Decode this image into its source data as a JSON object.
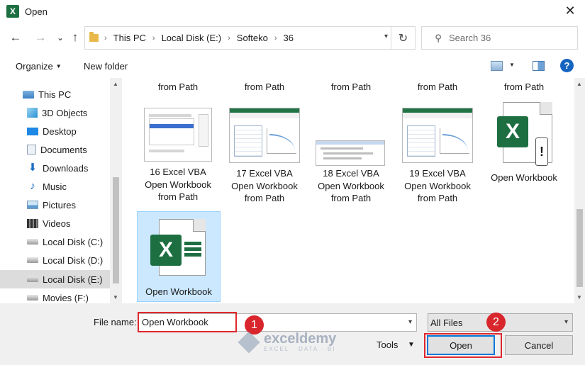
{
  "window": {
    "title": "Open",
    "close_glyph": "✕",
    "app_icon_letter": "X"
  },
  "nav": {
    "back_glyph": "←",
    "forward_glyph": "→",
    "recent_glyph": "⌄",
    "up_glyph": "↑",
    "breadcrumbs": [
      "This PC",
      "Local Disk (E:)",
      "Softeko",
      "36"
    ],
    "sep_glyph": "›",
    "refresh_glyph": "↻",
    "search_placeholder": "Search 36",
    "search_glyph": "⚲"
  },
  "toolbar": {
    "organize": "Organize",
    "new_folder": "New folder",
    "help": "?"
  },
  "sidebar": {
    "items": [
      {
        "label": "This PC",
        "icon": "computer-icon"
      },
      {
        "label": "3D Objects",
        "icon": "cube-icon"
      },
      {
        "label": "Desktop",
        "icon": "desktop-icon"
      },
      {
        "label": "Documents",
        "icon": "documents-icon"
      },
      {
        "label": "Downloads",
        "icon": "download-icon"
      },
      {
        "label": "Music",
        "icon": "music-icon"
      },
      {
        "label": "Pictures",
        "icon": "pictures-icon"
      },
      {
        "label": "Videos",
        "icon": "videos-icon"
      },
      {
        "label": "Local Disk (C:)",
        "icon": "drive-icon"
      },
      {
        "label": "Local Disk (D:)",
        "icon": "drive-icon"
      },
      {
        "label": "Local Disk (E:)",
        "icon": "drive-icon",
        "selected": true
      },
      {
        "label": "Movies (F:)",
        "icon": "drive-icon"
      }
    ]
  },
  "files": {
    "top_partial": [
      "from Path",
      "from Path",
      "from Path",
      "from Path",
      "from Path"
    ],
    "row2": [
      {
        "lines": [
          "16 Excel VBA",
          "Open Workbook",
          "from Path"
        ]
      },
      {
        "lines": [
          "17 Excel VBA",
          "Open Workbook",
          "from Path"
        ]
      },
      {
        "lines": [
          "18 Excel VBA",
          "Open Workbook",
          "from Path"
        ]
      },
      {
        "lines": [
          "19 Excel VBA",
          "Open Workbook",
          "from Path"
        ]
      },
      {
        "lines": [
          "Open Workbook"
        ]
      }
    ],
    "row3": [
      {
        "lines": [
          "Open Workbook"
        ],
        "selected": true
      }
    ]
  },
  "bottom": {
    "file_name_label": "File name:",
    "file_name_value": "Open Workbook",
    "filter_value": "All Files",
    "tools_label": "Tools",
    "open_label": "Open",
    "cancel_label": "Cancel",
    "badge_1": "1",
    "badge_2": "2",
    "watermark_name": "exceldemy",
    "watermark_sub": "EXCEL · DATA · BI"
  },
  "colors": {
    "accent": "#0078d7",
    "highlight_red": "#e0282e",
    "excel_green": "#1d6f42",
    "selection": "#cce8ff"
  }
}
